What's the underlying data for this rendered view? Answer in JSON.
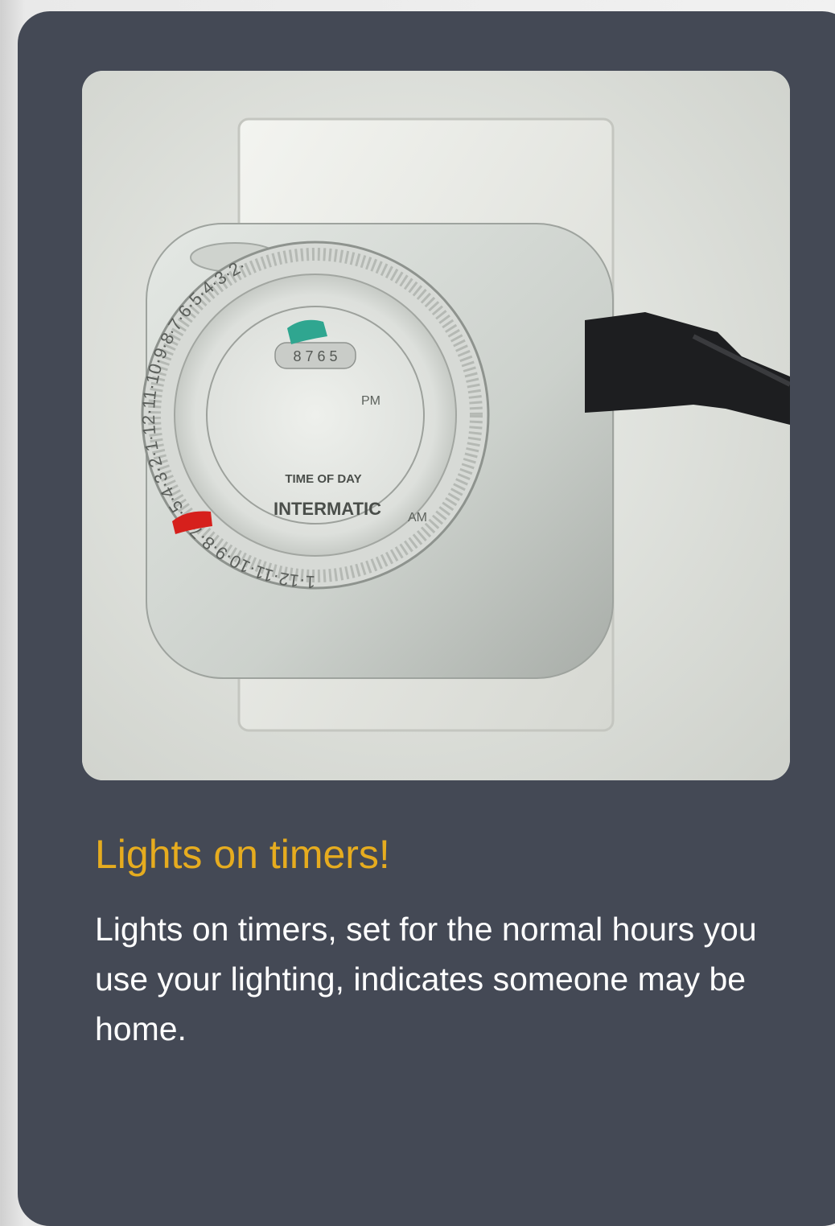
{
  "card": {
    "title": "Lights on timers!",
    "description": "Lights on timers, set for the normal hours you use your lighting, indicates someone may be home.",
    "title_color": "#e6ac1f",
    "background_color": "#444955"
  },
  "photo": {
    "dial_brand": "INTERMATIC",
    "dial_caption": "TIME OF DAY",
    "dial_pm": "PM",
    "dial_am": "AM",
    "dial_window": "8 7 6 5",
    "dial_ring": "1·12·11·10·9·8·7·6·5·4·3·2·1·12·11·10·9·8·7·6·5·4·3·2·"
  }
}
